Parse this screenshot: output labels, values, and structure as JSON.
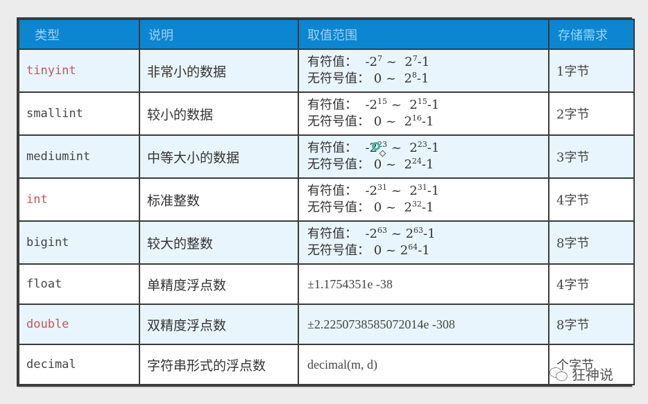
{
  "table": {
    "headers": [
      "类型",
      "说明",
      "取值范围",
      "存储需求"
    ],
    "rows": [
      {
        "type": "tinyint",
        "type_color": "#c8545a",
        "highlight": true,
        "desc": "非常小的数据",
        "signed_label": "有符值：",
        "signed_value": {
          "lo_base": "-2",
          "lo_exp": "7",
          "sep": " ~ ",
          "hi_base": "2",
          "hi_exp": "7",
          "hi_suffix": "-1"
        },
        "unsigned_label": "无符号值：",
        "unsigned_value": {
          "lo": "0",
          "sep": " ~ ",
          "hi_base": "2",
          "hi_exp": "8",
          "hi_suffix": "-1"
        },
        "storage": "1字节"
      },
      {
        "type": "smallint",
        "type_color": "#444444",
        "highlight": false,
        "desc": "较小的数据",
        "signed_label": "有符值：",
        "signed_value": {
          "lo_base": "-2",
          "lo_exp": "15",
          "sep": " ~ ",
          "hi_base": "2",
          "hi_exp": "15",
          "hi_suffix": "-1"
        },
        "unsigned_label": "无符号值：",
        "unsigned_value": {
          "lo": "0",
          "sep": " ~ ",
          "hi_base": "2",
          "hi_exp": "16",
          "hi_suffix": "-1"
        },
        "storage": "2字节"
      },
      {
        "type": "mediumint",
        "type_color": "#444444",
        "highlight": false,
        "desc": "中等大小的数据",
        "signed_label": "有符值：",
        "signed_value": {
          "lo_base": "-2",
          "lo_exp": "23",
          "sep": " ~ ",
          "hi_base": "2",
          "hi_exp": "23",
          "hi_suffix": "-1"
        },
        "unsigned_label": "无符号值：",
        "unsigned_value": {
          "lo": "0",
          "sep": " ~ ",
          "hi_base": "2",
          "hi_exp": "24",
          "hi_suffix": "-1"
        },
        "storage": "3字节"
      },
      {
        "type": "int",
        "type_color": "#c8545a",
        "highlight": true,
        "desc": "标准整数",
        "signed_label": "有符值：",
        "signed_value": {
          "lo_base": "-2",
          "lo_exp": "31",
          "sep": " ~ ",
          "hi_base": "2",
          "hi_exp": "31",
          "hi_suffix": "-1"
        },
        "unsigned_label": "无符号值：",
        "unsigned_value": {
          "lo": "0",
          "sep": " ~ ",
          "hi_base": "2",
          "hi_exp": "32",
          "hi_suffix": "-1"
        },
        "storage": "4字节"
      },
      {
        "type": "bigint",
        "type_color": "#444444",
        "highlight": false,
        "desc": "较大的整数",
        "signed_label": "有符值：",
        "signed_value": {
          "lo_base": "-2",
          "lo_exp": "63",
          "sep": " ~",
          "hi_base": "2",
          "hi_exp": "63",
          "hi_suffix": "-1"
        },
        "unsigned_label": "无符号值：",
        "unsigned_value": {
          "lo": "0",
          "sep": " ~",
          "hi_base": "2",
          "hi_exp": "64",
          "hi_suffix": "-1"
        },
        "storage": "8字节"
      },
      {
        "type": "float",
        "type_color": "#444444",
        "highlight": false,
        "desc": "单精度浮点数",
        "range_text": "±1.1754351e -38",
        "storage": "4字节"
      },
      {
        "type": "double",
        "type_color": "#c8545a",
        "highlight": true,
        "desc": "双精度浮点数",
        "range_text": "±2.2250738585072014e -308",
        "storage": "8字节"
      },
      {
        "type": "decimal",
        "type_color": "#444444",
        "highlight": false,
        "desc": "字符串形式的浮点数",
        "range_text": "decimal(m, d)",
        "storage": "个字节"
      }
    ]
  },
  "watermark": {
    "icon": "wechat-icon",
    "text": "狂神说"
  },
  "colors": {
    "header_bg": "#0c86d0",
    "header_text": "#9fd2f2",
    "alt_row_bg": "#e8f5fc",
    "red_text": "#c8545a"
  }
}
